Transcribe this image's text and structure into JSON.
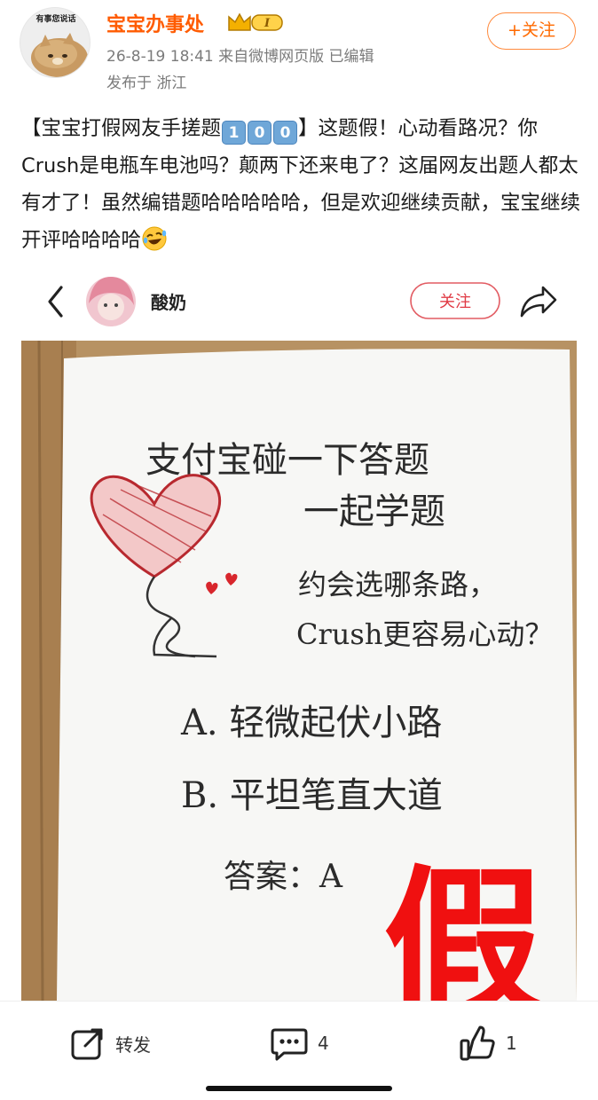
{
  "header": {
    "avatar_caption": "有事您说话",
    "username": "宝宝办事处",
    "badge_level": "I",
    "meta_line": "26-8-19 18:41  来自微博网页版  已编辑",
    "location": "发布于 浙江",
    "follow_label": "+关注",
    "accent_color": "#ff5b00"
  },
  "post": {
    "text_a": "【宝宝打假网友手搓题",
    "keys": [
      "1",
      "0",
      "0"
    ],
    "text_b": "】这题假！心动看路况？你Crush是电瓶车电池吗？颠两下还来电了？这届网友出题人都太有才了！虽然编错题哈哈哈哈哈，但是欢迎继续贡献，宝宝继续开评哈哈哈哈",
    "emoji": "rofl-emoji"
  },
  "embedded": {
    "author_name": "酸奶",
    "follow_label": "关注",
    "paper_line1": "支付宝碰一下答题",
    "paper_line2": "一起学题",
    "paper_q1": "约会选哪条路，",
    "paper_q2": "Crush更容易心动？",
    "paper_a": "A. 轻微起伏小路",
    "paper_b": "B. 平坦笔直大道",
    "paper_answer": "答案：A",
    "stamp": "假",
    "stamp_color": "#f01010"
  },
  "footer": {
    "repost_label": "转发",
    "comment_count": "4",
    "like_count": "1"
  }
}
